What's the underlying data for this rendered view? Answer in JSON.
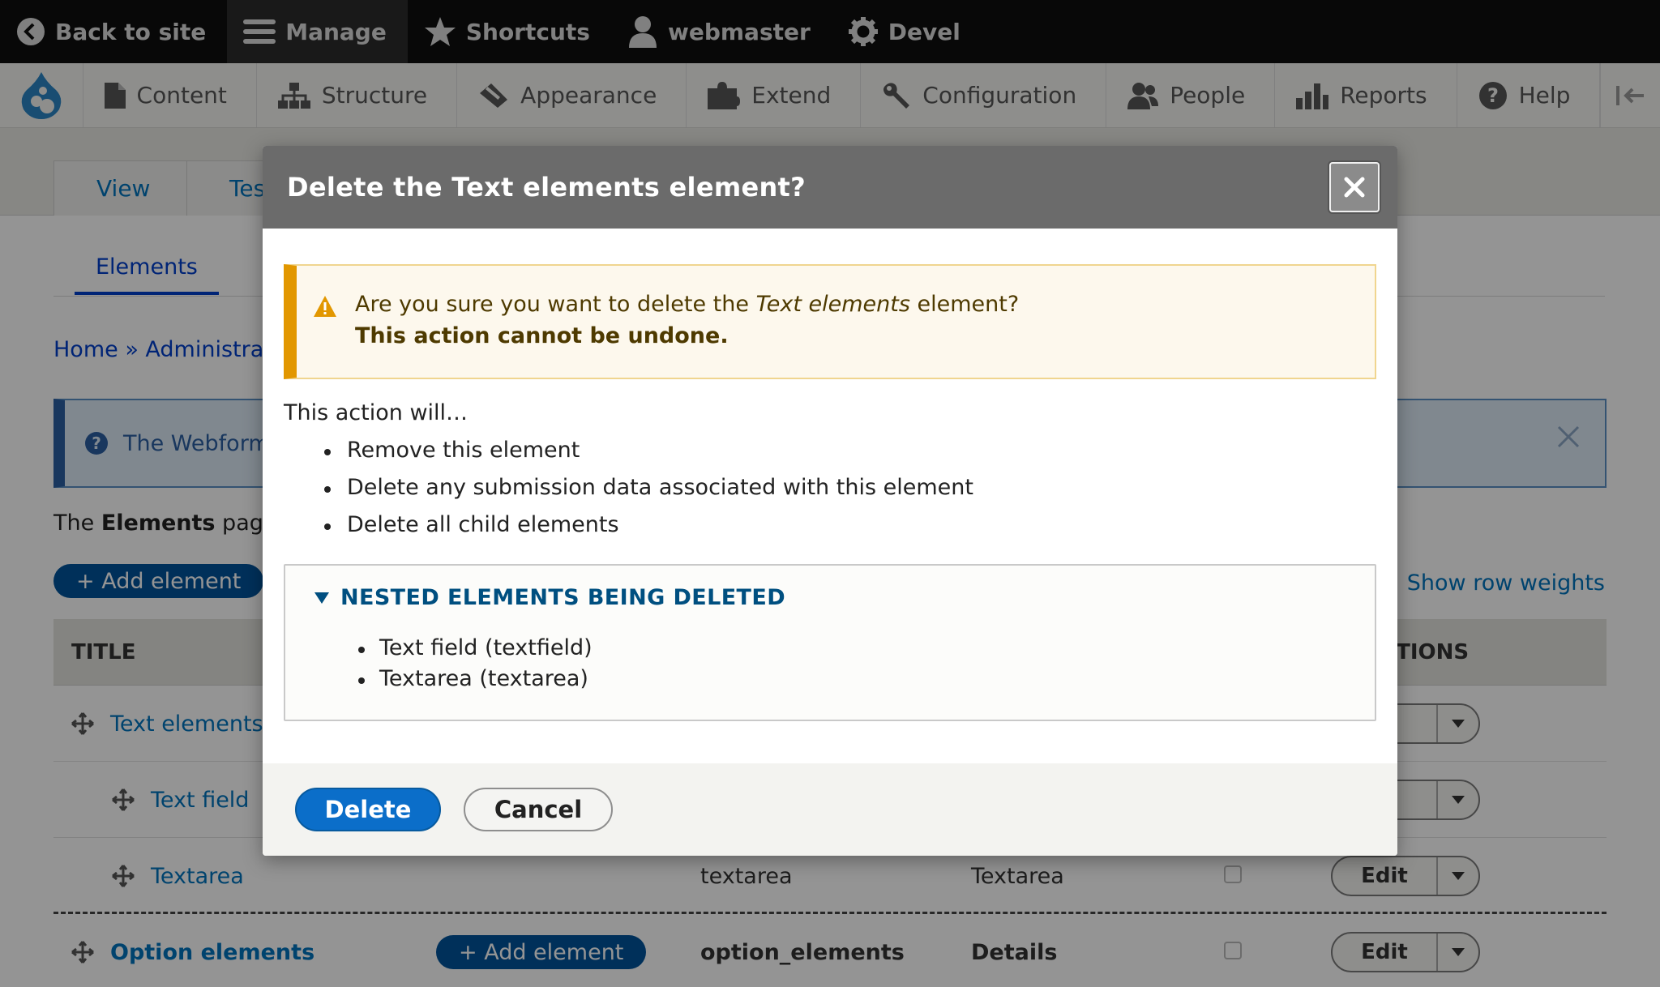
{
  "toolbar": {
    "back_label": "Back to site",
    "manage_label": "Manage",
    "shortcuts_label": "Shortcuts",
    "user_label": "webmaster",
    "devel_label": "Devel"
  },
  "tray": {
    "items": [
      {
        "label": "Content",
        "icon": "file-icon"
      },
      {
        "label": "Structure",
        "icon": "sitemap-icon"
      },
      {
        "label": "Appearance",
        "icon": "paintbrush-icon"
      },
      {
        "label": "Extend",
        "icon": "puzzle-icon"
      },
      {
        "label": "Configuration",
        "icon": "wrench-icon"
      },
      {
        "label": "People",
        "icon": "people-icon"
      },
      {
        "label": "Reports",
        "icon": "bar-chart-icon"
      },
      {
        "label": "Help",
        "icon": "question-icon"
      }
    ]
  },
  "page": {
    "tabs": [
      "View",
      "Tes"
    ],
    "secondary_tab": "Elements",
    "breadcrumb": "Home » Administrati",
    "help_text": "The Webform",
    "intro_prefix": "The ",
    "intro_bold": "Elements",
    "intro_suffix": " page",
    "add_element_label": "+ Add element",
    "row_weights_label": "Show row weights",
    "table": {
      "col_title": "TITLE",
      "col_operations": "ATIONS",
      "rows": [
        {
          "title": "Text elements",
          "key": "",
          "type": "",
          "edit": "t"
        },
        {
          "title": "Text field",
          "key": "",
          "type": "",
          "edit": "t"
        },
        {
          "title": "Textarea",
          "key": "textarea",
          "type": "Textarea",
          "edit": "Edit"
        },
        {
          "title": "Option elements",
          "key": "option_elements",
          "type": "Details",
          "edit": "Edit",
          "add": "+ Add element"
        }
      ]
    }
  },
  "dialog": {
    "title": "Delete the Text elements element?",
    "warning_prefix": "Are you sure you want to delete the ",
    "warning_item": "Text elements",
    "warning_suffix": " element?",
    "warning_bold": "This action cannot be undone.",
    "action_intro": "This action will…",
    "actions": [
      "Remove this element",
      "Delete any submission data associated with this element",
      "Delete all child elements"
    ],
    "nested_summary": "NESTED ELEMENTS BEING DELETED",
    "nested_items": [
      "Text field (textfield)",
      "Textarea (textarea)"
    ],
    "delete_label": "Delete",
    "cancel_label": "Cancel"
  },
  "colors": {
    "primary_button": "#0b6ec9",
    "warning_accent": "#e29700",
    "link": "#0074bd"
  }
}
